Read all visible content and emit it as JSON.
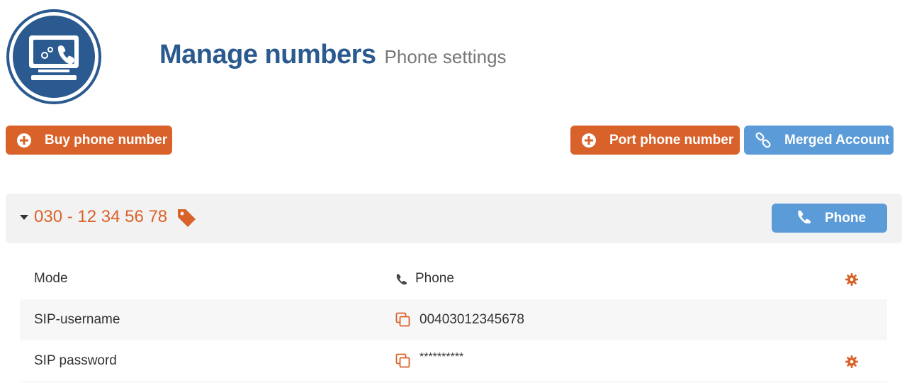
{
  "header": {
    "title": "Manage numbers",
    "subtitle": "Phone settings",
    "logo_icon": "monitor-phone-gear-icon"
  },
  "actions": {
    "buy_label": "Buy phone number",
    "port_label": "Port phone number",
    "merged_label": "Merged Account"
  },
  "number": {
    "value": "030 - 12 34 56 78",
    "phone_button_label": "Phone"
  },
  "settings": [
    {
      "label": "Mode",
      "value": "Phone",
      "icon": "phone-icon",
      "has_gear": true
    },
    {
      "label": "SIP-username",
      "value": "00403012345678",
      "icon": "copy-icon",
      "has_gear": false
    },
    {
      "label": "SIP password",
      "value": "**********",
      "icon": "copy-icon",
      "has_gear": true
    }
  ],
  "colors": {
    "brand_blue": "#2a5a8f",
    "accent_orange": "#d9622b",
    "button_blue": "#5b9bd8"
  }
}
